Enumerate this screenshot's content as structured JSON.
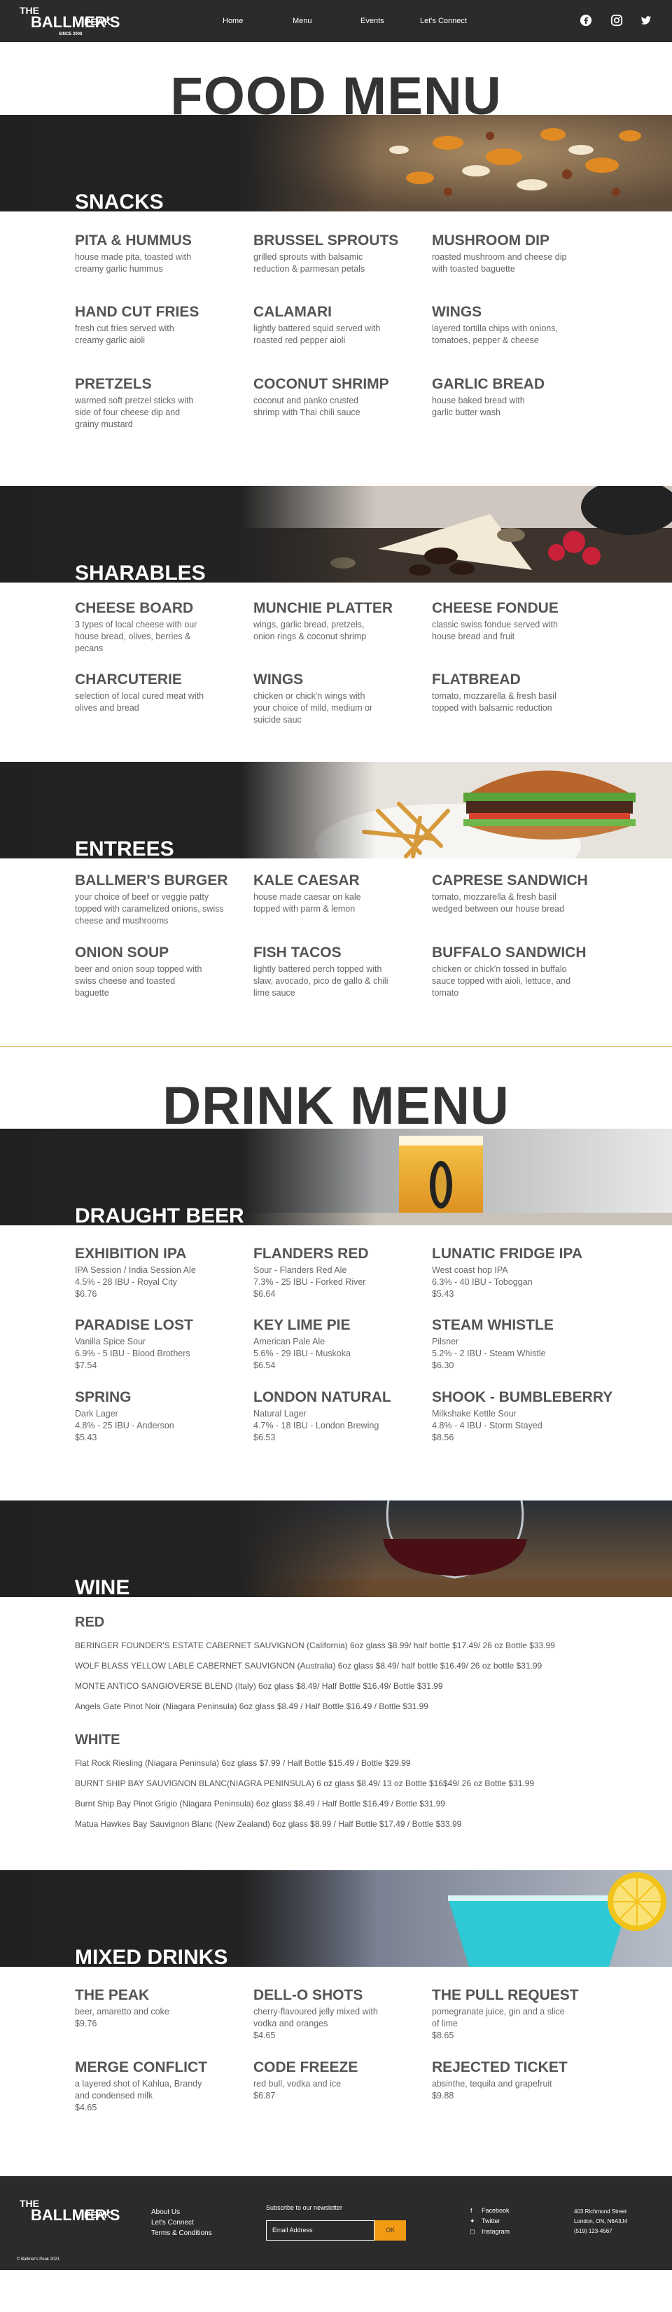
{
  "nav": {
    "logo_lines": [
      "THE",
      "BALLMER'S",
      "PEAK",
      "SINCE 2008"
    ],
    "links": [
      "Home",
      "Menu",
      "Events",
      "Let's Connect"
    ],
    "social_icons": [
      "facebook-icon",
      "instagram-icon",
      "twitter-icon"
    ]
  },
  "food_menu": {
    "title": "FOOD MENU",
    "snacks": {
      "heading": "SNACKS",
      "items": [
        {
          "name": "PITA & HUMMUS",
          "desc": "house made pita, toasted with creamy garlic hummus"
        },
        {
          "name": "BRUSSEL SPROUTS",
          "desc": "grilled sprouts with balsamic reduction & parmesan petals"
        },
        {
          "name": "MUSHROOM DIP",
          "desc": "roasted mushroom and cheese dip with toasted baguette"
        },
        {
          "name": "HAND CUT FRIES",
          "desc": "fresh cut fries served with creamy garlic aioli"
        },
        {
          "name": "CALAMARI",
          "desc": "lightly battered squid served with roasted red pepper aioli"
        },
        {
          "name": "WINGS",
          "desc": "layered tortilla chips with onions, tomatoes, pepper & cheese"
        },
        {
          "name": "PRETZELS",
          "desc": "warmed soft pretzel sticks with side of four cheese dip and grainy mustard"
        },
        {
          "name": "COCONUT SHRIMP",
          "desc": "coconut and panko crusted shrimp with Thai chili sauce"
        },
        {
          "name": "GARLIC BREAD",
          "desc": "house baked bread with garlic butter wash"
        }
      ]
    },
    "sharables": {
      "heading": "SHARABLES",
      "items": [
        {
          "name": "CHEESE BOARD",
          "desc": "3 types of local cheese with our house bread, olives, berries & pecans"
        },
        {
          "name": "MUNCHIE PLATTER",
          "desc": "wings, garlic bread, pretzels, onion rings & coconut shrimp"
        },
        {
          "name": "CHEESE FONDUE",
          "desc": "classic swiss fondue served with house bread and fruit"
        },
        {
          "name": "CHARCUTERIE",
          "desc": "selection of local cured meat with olives and bread"
        },
        {
          "name": "WINGS",
          "desc": "chicken or chick'n wings with your choice of mild, medium or suicide sauc"
        },
        {
          "name": "FLATBREAD",
          "desc": "tomato, mozzarella & fresh basil topped with balsamic reduction"
        }
      ]
    },
    "entrees": {
      "heading": "ENTREES",
      "items": [
        {
          "name": "BALLMER'S BURGER",
          "desc": "your choice of beef or veggie patty topped with caramelized onions, swiss cheese and mushrooms"
        },
        {
          "name": "KALE CAESAR",
          "desc": "house made caesar on kale  topped with parm & lemon"
        },
        {
          "name": "CAPRESE SANDWICH",
          "desc": "tomato, mozzarella & fresh basil wedged between our house bread"
        },
        {
          "name": "ONION SOUP",
          "desc": "beer and onion soup topped with swiss cheese and toasted baguette"
        },
        {
          "name": "FISH TACOS",
          "desc": "lightly battered perch topped with slaw, avocado, pico de gallo & chili lime sauce"
        },
        {
          "name": "BUFFALO SANDWICH",
          "desc": "chicken or chick'n tossed in buffalo sauce topped with aioli, lettuce, and tomato"
        }
      ]
    }
  },
  "drink_menu": {
    "title": "DRINK MENU",
    "draught": {
      "heading": "DRAUGHT BEER",
      "items": [
        {
          "name": "EXHIBITION IPA",
          "desc": "IPA Session / India Session Ale",
          "stats": "4.5% - 28 IBU - Royal City",
          "price": "$6.76"
        },
        {
          "name": "FLANDERS RED",
          "desc": "Sour - Flanders Red Ale",
          "stats": "7.3% - 25 IBU - Forked River",
          "price": "$6.64"
        },
        {
          "name": "LUNATIC FRIDGE IPA",
          "desc": "West coast hop IPA",
          "stats": "6.3% - 40 IBU - Toboggan",
          "price": "$5.43"
        },
        {
          "name": "PARADISE LOST",
          "desc": "Vanilla Spice Sour",
          "stats": "6.9% - 5 IBU - Blood Brothers",
          "price": "$7.54"
        },
        {
          "name": "KEY LIME PIE",
          "desc": "American Pale Ale",
          "stats": "5.6% - 29 IBU - Muskoka",
          "price": "$6.54"
        },
        {
          "name": "STEAM WHISTLE",
          "desc": "Pilsner",
          "stats": "5.2% - 2 IBU - Steam Whistle",
          "price": "$6.30"
        },
        {
          "name": "SPRING",
          "desc": "Dark Lager",
          "stats": "4.8% - 25 IBU - Anderson",
          "price": "$5.43"
        },
        {
          "name": "LONDON NATURAL",
          "desc": "Natural Lager",
          "stats": "4.7% - 18 IBU - London Brewing",
          "price": "$6.53"
        },
        {
          "name": "SHOOK - BUMBLEBERRY",
          "desc": "Milkshake Kettle Sour",
          "stats": "4.8% - 4 IBU - Storm Stayed",
          "price": "$8.56"
        }
      ]
    },
    "wine": {
      "heading": "WINE",
      "red_heading": "RED",
      "red": [
        "BERINGER FOUNDER'S ESTATE CABERNET SAUVIGNON (California) 6oz glass $8.99/ half bottle $17.49/ 26 oz Bottle $33.99",
        "WOLF BLASS YELLOW LABLE CABERNET SAUVIGNON (Australia) 6oz glass $8.49/ half bottle $16.49/ 26 oz bottle $31.99",
        "MONTE ANTICO SANGIOVERSE BLEND (Italy) 6oz glass $8.49/ Half Bottle $16.49/ Bottle $31.99",
        "Angels Gate Pinot Noir (Niagara Peninsula) 6oz glass $8.49 / Half Bottle $16.49 / Bottle $31.99"
      ],
      "white_heading": "WHITE",
      "white": [
        "Flat Rock Riesling (Niagara Peninsula) 6oz glass $7.99 / Half Bottle $15.49 / Bottle $29.99",
        "BURNT SHIP BAY SAUVIGNON BLANC(NIAGRA PENINSULA) 6 oz glass $8.49/ 13 oz Bottle $16$49/ 26 oz Bottle $31.99",
        "Burnt Ship Bay Pinot Grigio (Niagara Peninsula) 6oz glass $8.49 / Half Bottle $16.49 / Bottle $31.99",
        "Matua Hawkes Bay Sauvignon Blanc (New Zealand) 6oz glass $8.99 / Half Bottle $17.49 / Bottle $33.99"
      ]
    },
    "mixed": {
      "heading": "MIXED DRINKS",
      "items": [
        {
          "name": "THE PEAK",
          "desc": "beer, amaretto and coke",
          "price": "$9.76"
        },
        {
          "name": "DELL-O SHOTS",
          "desc": "cherry-flavoured jelly mixed with vodka and oranges",
          "price": "$4.65"
        },
        {
          "name": "THE PULL REQUEST",
          "desc": "pomegranate juice, gin and a slice of lime",
          "price": "$8.65"
        },
        {
          "name": "MERGE CONFLICT",
          "desc": "a layered shot of Kahlua, Brandy and condensed milk",
          "price": "$4.65"
        },
        {
          "name": "CODE FREEZE",
          "desc": "red bull, vodka and ice",
          "price": "$6.87"
        },
        {
          "name": "REJECTED TICKET",
          "desc": "absinthe, tequila and grapefruit",
          "price": "$9.88"
        }
      ]
    }
  },
  "footer": {
    "links": [
      "About Us",
      "Let's Connect",
      "Terms & Conditions"
    ],
    "newsletter_label": "Subscribe to our newsletter",
    "email_placeholder": "Email Address",
    "ok_label": "OK",
    "socials": [
      "Facebook",
      "Twitter",
      "Instagram"
    ],
    "address": [
      "403 Richmond Street",
      "London, ON, N6A3J4",
      "(519) 123-4567"
    ],
    "copyright": "© Ballmer's Peak 2021"
  },
  "colors": {
    "nav_bg": "#2b2b2b",
    "accent": "#f29b12",
    "divider": "#e8c36b"
  }
}
